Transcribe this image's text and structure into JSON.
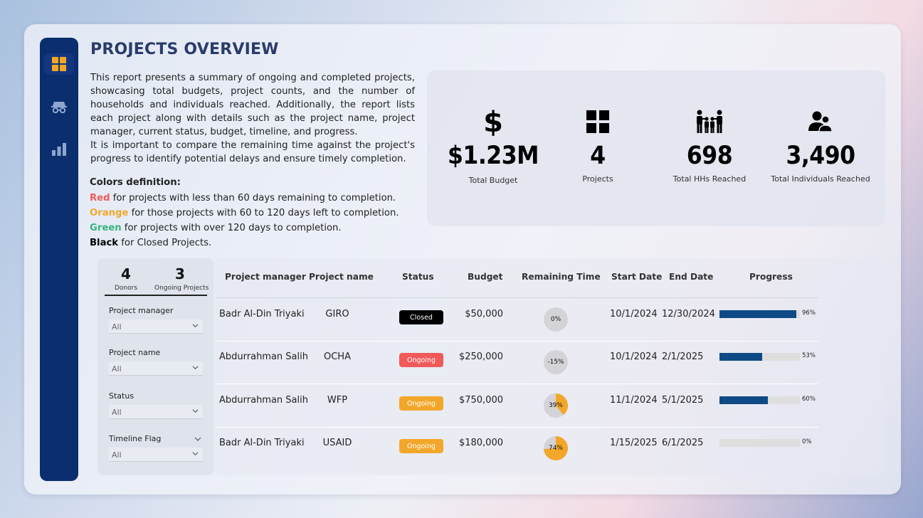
{
  "header": {
    "title": "PROJECTS OVERVIEW"
  },
  "description": {
    "paragraph1": "This report presents a summary of ongoing and completed projects, showcasing total budgets, project counts, and the number of households and individuals reached. Additionally, the report lists each project along with details such as the project name, project manager, current status, budget, timeline, and progress.",
    "paragraph2": "It is important to compare the remaining time against the project's progress to identify potential delays and ensure timely completion."
  },
  "colors_definition": {
    "heading": "Colors definition:",
    "items": [
      {
        "keyword": "Red",
        "text": " for projects with less than 60 days remaining to completion.",
        "color": "#f05a5a"
      },
      {
        "keyword": "Orange",
        "text": " for those projects with 60 to 120 days left to completion.",
        "color": "#f3a72a"
      },
      {
        "keyword": "Green",
        "text": " for projects with over 120 days to completion.",
        "color": "#35b47e"
      },
      {
        "keyword": "Black",
        "text": " for Closed Projects.",
        "color": "#000000"
      }
    ]
  },
  "sidebar": {
    "items": [
      {
        "name": "dashboard-grid-icon",
        "active": true
      },
      {
        "name": "incognito-icon",
        "active": false
      },
      {
        "name": "bar-chart-icon",
        "active": false
      }
    ]
  },
  "kpis": [
    {
      "icon": "dollar-icon",
      "value": "$1.23M",
      "label": "Total Budget"
    },
    {
      "icon": "grid-icon",
      "value": "4",
      "label": "Projects"
    },
    {
      "icon": "family-icon",
      "value": "698",
      "label": "Total HHs Reached"
    },
    {
      "icon": "users-icon",
      "value": "3,490",
      "label": "Total Individuals Reached"
    }
  ],
  "slicer": {
    "donors": {
      "value": "4",
      "label": "Donors"
    },
    "ongoing": {
      "value": "3",
      "label": "Ongoing Projects"
    },
    "filters": [
      {
        "label": "Project manager",
        "value": "All"
      },
      {
        "label": "Project name",
        "value": "All"
      },
      {
        "label": "Status",
        "value": "All"
      },
      {
        "label": "Timeline Flag",
        "value": "All"
      }
    ]
  },
  "table": {
    "headers": [
      "Project manager",
      "Project name",
      "Status",
      "Budget",
      "Remaining Time",
      "Start Date",
      "End Date",
      "Progress"
    ],
    "rows": [
      {
        "manager": "Badr Al-Din Triyaki",
        "project": "GIRO",
        "status": "Closed",
        "status_color": "#000000",
        "budget": "$50,000",
        "remaining_label": "0%",
        "remaining_value": 0,
        "remaining_color": "#f3a72a",
        "start": "10/1/2024",
        "end": "12/30/2024",
        "progress_label": "96%",
        "progress_value": 96
      },
      {
        "manager": "Abdurrahman Salih",
        "project": "OCHA",
        "status": "Ongoing",
        "status_color": "#f05a5a",
        "budget": "$250,000",
        "remaining_label": "-15%",
        "remaining_value": 0,
        "remaining_color": "#f3a72a",
        "start": "10/1/2024",
        "end": "2/1/2025",
        "progress_label": "53%",
        "progress_value": 53
      },
      {
        "manager": "Abdurrahman Salih",
        "project": "WFP",
        "status": "Ongoing",
        "status_color": "#f3a72a",
        "budget": "$750,000",
        "remaining_label": "39%",
        "remaining_value": 39,
        "remaining_color": "#f3a72a",
        "start": "11/1/2024",
        "end": "5/1/2025",
        "progress_label": "60%",
        "progress_value": 60
      },
      {
        "manager": "Badr Al-Din Triyaki",
        "project": "USAID",
        "status": "Ongoing",
        "status_color": "#f3a72a",
        "budget": "$180,000",
        "remaining_label": "74%",
        "remaining_value": 74,
        "remaining_color": "#f3a72a",
        "start": "1/15/2025",
        "end": "6/1/2025",
        "progress_label": "0%",
        "progress_value": 0
      }
    ]
  }
}
